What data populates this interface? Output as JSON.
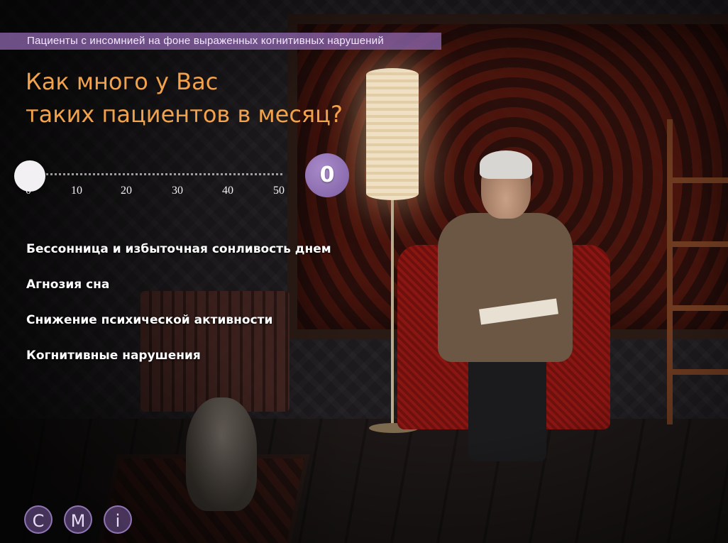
{
  "header": {
    "category": "Пациенты с инсомнией на фоне выраженных когнитивных нарушений"
  },
  "question": {
    "line1": "Как много у Вас",
    "line2": "таких пациентов в месяц?"
  },
  "slider": {
    "min": 0,
    "max": 50,
    "current_value": 0,
    "value_display": "0",
    "ticks": [
      "0",
      "10",
      "20",
      "30",
      "40",
      "50"
    ]
  },
  "symptoms": [
    "Бессонница и избыточная сонливость днем",
    "Агнозия сна",
    "Снижение психической активности",
    "Когнитивные нарушения"
  ],
  "nav": {
    "buttons": [
      "C",
      "M",
      "i"
    ]
  },
  "colors": {
    "accent_orange": "#f2a24b",
    "accent_purple": "#8a64aa",
    "text_white": "#ffffff"
  }
}
